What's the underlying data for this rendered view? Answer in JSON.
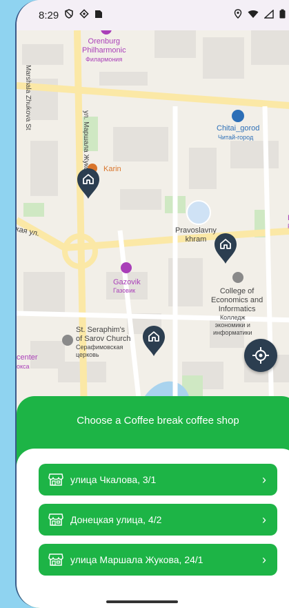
{
  "status": {
    "time": "8:29"
  },
  "map": {
    "pois": {
      "philharmonic_en": "Orenburg\nPhilharmonic",
      "philharmonic_ru": "Филармония",
      "chitai_en": "Chitai_gorod",
      "chitai_ru": "Читай-город",
      "karin": "Karin",
      "pravoslavny": "Pravoslavny\nkhram",
      "gazovik_en": "Gazovik",
      "gazovik_ru": "Газовик",
      "college_en": "College of\nEconomics and\nInformatics",
      "college_ru": "Колледж\nэкономики и\nинформатики",
      "church_en": "St. Seraphim's\nof Sarov Church",
      "church_ru": "Серафимовская\nцерковь",
      "center_en": "center",
      "center_ru": "окса",
      "re": "Re",
      "pe": "Ре"
    },
    "roads": {
      "marshala_en": "Marshala Zhukova St",
      "marshala_ru": "ул. Маршала Жукова",
      "kaya": "кая ул."
    }
  },
  "sheet": {
    "title": "Choose a Coffee break coffee shop",
    "shops": [
      {
        "label": "улица Чкалова, 3/1"
      },
      {
        "label": "Донецкая улица, 4/2"
      },
      {
        "label": "улица Маршала Жукова, 24/1"
      }
    ]
  },
  "icons": {
    "shop": "storefront-icon",
    "chevron": "chevron-right-icon",
    "pin": "home-pin-icon",
    "locate": "crosshair-icon"
  },
  "colors": {
    "accent": "#1db446",
    "pin": "#2c3e50",
    "button_bg": "#2c3e50"
  }
}
